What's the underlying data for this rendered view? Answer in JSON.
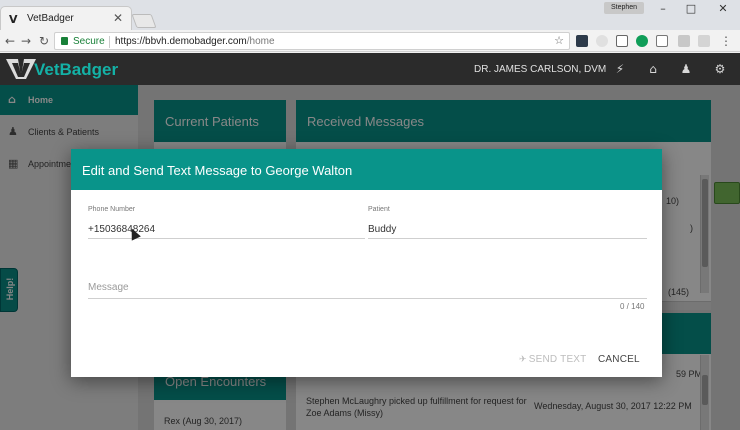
{
  "browser": {
    "tab_title": "VetBadger",
    "tab_close": "✕",
    "profile_name": "Stephen",
    "secure_label": "Secure",
    "url_host": "https://bbvh.demobadger.com",
    "url_path": "/home"
  },
  "app": {
    "logo_text": "VetBadger",
    "doctor_name": "DR. JAMES CARLSON, DVM"
  },
  "sidebar": {
    "items": [
      {
        "label": "Home",
        "icon": "home-icon",
        "active": true
      },
      {
        "label": "Clients & Patients",
        "icon": "users-icon",
        "active": false
      },
      {
        "label": "Appointme",
        "icon": "calendar-icon",
        "active": false
      }
    ],
    "help_label": "Help!"
  },
  "cards": {
    "current_patients": "Current Patients",
    "received_messages": "Received Messages",
    "open_encounters": "Open Encounters",
    "encounter_item": "Rex (Aug 30, 2017)",
    "count_a": "10)",
    "count_b": "(145)",
    "fragment_b": ")",
    "message_text": "Stephen McLaughry picked up fulfillment for request for Zoe Adams (Missy)",
    "message_time": "Wednesday, August 30, 2017 12:22 PM",
    "prev_time_fragment": "59 PM"
  },
  "modal": {
    "title": "Edit and Send Text Message to George Walton",
    "phone_label": "Phone Number",
    "phone_value": "+15036848264",
    "patient_label": "Patient",
    "patient_value": "Buddy",
    "message_placeholder": "Message",
    "counter": "0 / 140",
    "send_label": "SEND TEXT",
    "cancel_label": "CANCEL"
  },
  "colors": {
    "teal": "#09948a",
    "header_dark": "#2b2b2b",
    "logo_teal": "#14b1a6"
  }
}
